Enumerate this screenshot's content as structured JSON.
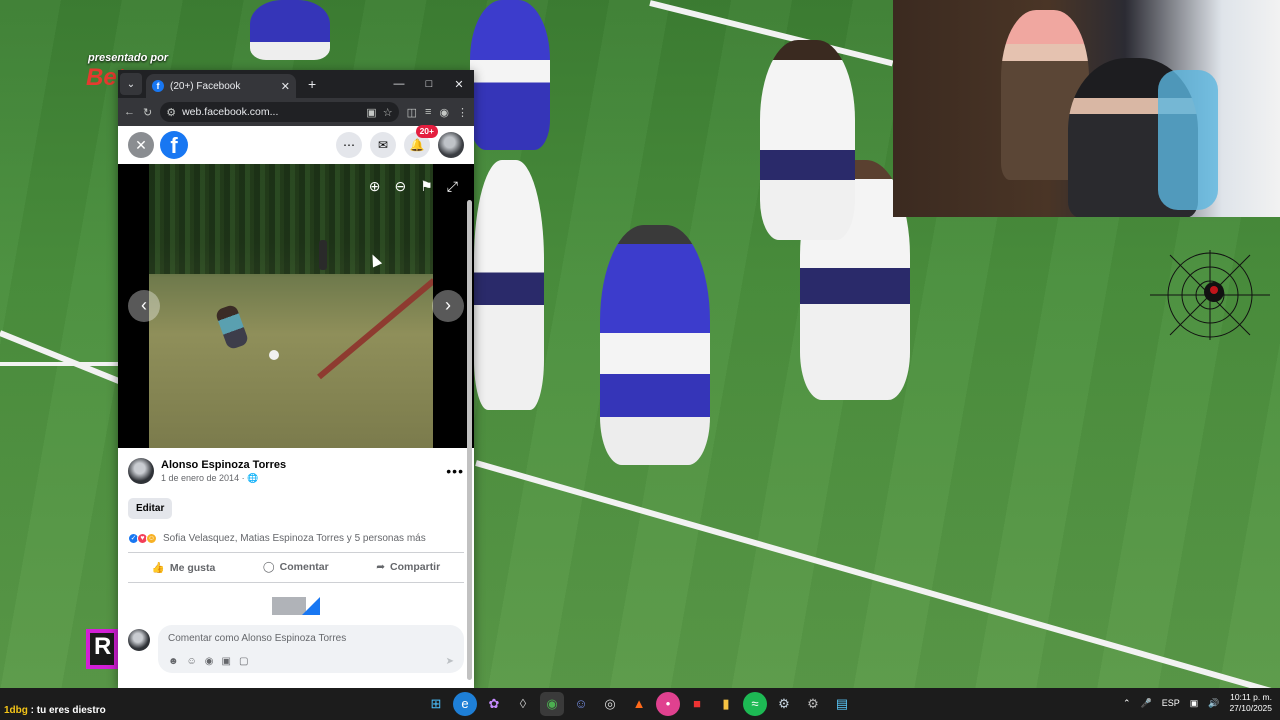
{
  "stream": {
    "sponsor_text": "presentado por",
    "sponsor_logo": "Bet",
    "side_logo": "R",
    "chat_user": "1dbg",
    "chat_message": " : tu eres diestro"
  },
  "browser": {
    "tab_title": "(20+) Facebook",
    "url": "web.facebook.com..."
  },
  "facebook": {
    "notif_count": "20+",
    "author": "Alonso Espinoza Torres",
    "date": "1 de enero de 2014 ·",
    "edit_label": "Editar",
    "reactions_text": "Sofia Velasquez, Matias Espinoza Torres y 5 personas más",
    "like_label": "Me gusta",
    "comment_label": "Comentar",
    "share_label": "Compartir",
    "comment_placeholder": "Comentar como Alonso Espinoza Torres"
  },
  "taskbar": {
    "apps": [
      "windows-start",
      "edge",
      "copilot",
      "app-store",
      "chrome",
      "discord",
      "obs",
      "brave",
      "app-pink",
      "app-dark",
      "folder",
      "spotify",
      "steam",
      "settings",
      "notepad"
    ],
    "language": "ESP",
    "time": "10:11 p. m.",
    "date": "27/10/2025"
  },
  "colors": {
    "facebook_blue": "#1877f2",
    "taskbar": "#1c1c1c",
    "field": "#4a8f3d"
  }
}
